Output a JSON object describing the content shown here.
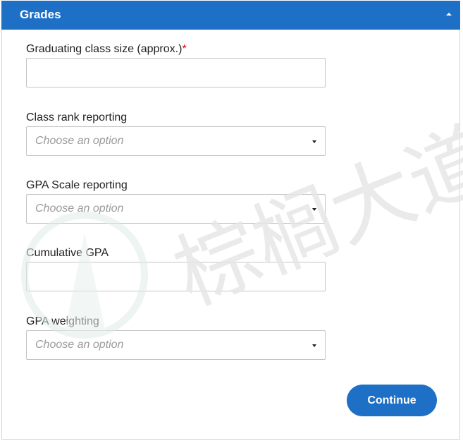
{
  "header": {
    "title": "Grades"
  },
  "form": {
    "class_size": {
      "label": "Graduating class size (approx.)",
      "required_mark": "*",
      "value": ""
    },
    "class_rank": {
      "label": "Class rank reporting",
      "placeholder": "Choose an option"
    },
    "gpa_scale": {
      "label": "GPA Scale reporting",
      "placeholder": "Choose an option"
    },
    "cumulative_gpa": {
      "label": "Cumulative GPA",
      "value": ""
    },
    "gpa_weighting": {
      "label": "GPA weighting",
      "placeholder": "Choose an option"
    }
  },
  "actions": {
    "continue_label": "Continue"
  },
  "watermark": {
    "text": "棕榈大道"
  },
  "colors": {
    "accent": "#1e6fc6",
    "required": "#d0021b",
    "watermark": "#e6e6e6",
    "watermark_logo": "#dfece8"
  }
}
